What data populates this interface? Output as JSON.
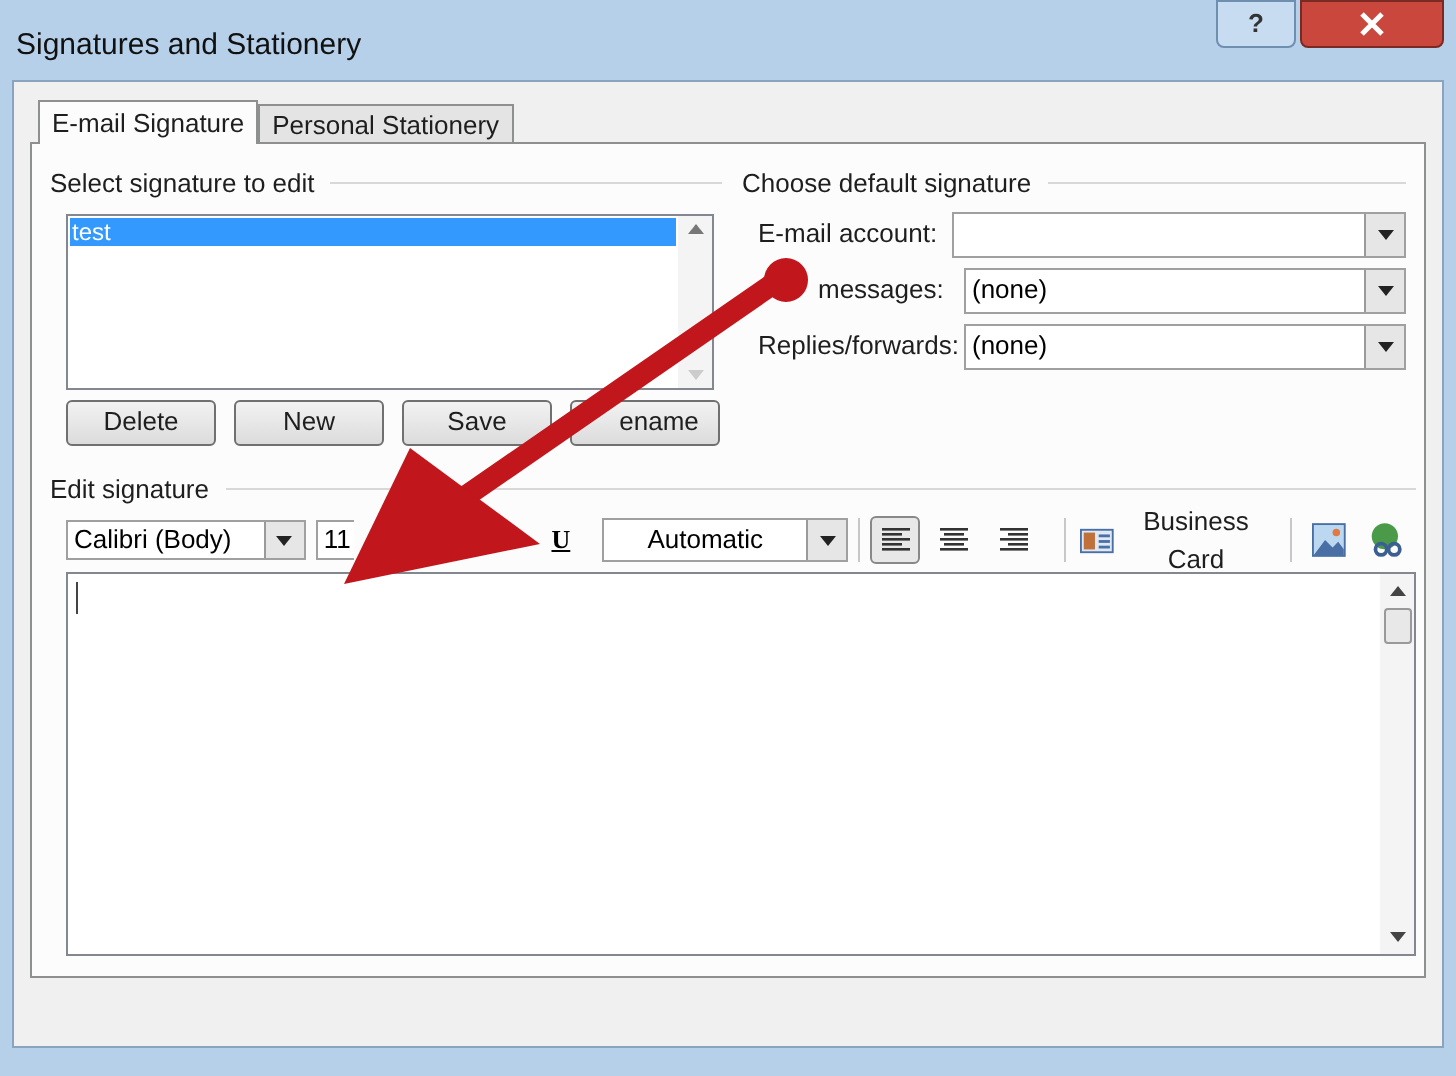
{
  "window": {
    "title": "Signatures and Stationery",
    "help": "?"
  },
  "tabs": [
    {
      "label": "E-mail Signature",
      "selected": true
    },
    {
      "label": "Personal Stationery",
      "selected": false
    }
  ],
  "select_signature": {
    "heading": "Select signature to edit",
    "items": [
      {
        "label": "test",
        "selected": true
      }
    ],
    "buttons": [
      "Delete",
      "New",
      "Save",
      "ename"
    ]
  },
  "default_signature": {
    "heading": "Choose default signature",
    "fields": [
      {
        "label": "E-mail account:"
      },
      {
        "label": "messages:",
        "value": "(none)"
      },
      {
        "label": "Replies/forwards:",
        "value": "(none)"
      }
    ]
  },
  "edit_signature": {
    "heading": "Edit signature",
    "font": "Calibri (Body)",
    "size": "11",
    "underline": "U",
    "font_color_setting": "Automatic",
    "alignment": [
      {
        "kind": "left",
        "selected": true
      },
      {
        "kind": "center",
        "selected": false
      },
      {
        "kind": "right",
        "selected": false
      }
    ],
    "business_card": "Business Card"
  }
}
